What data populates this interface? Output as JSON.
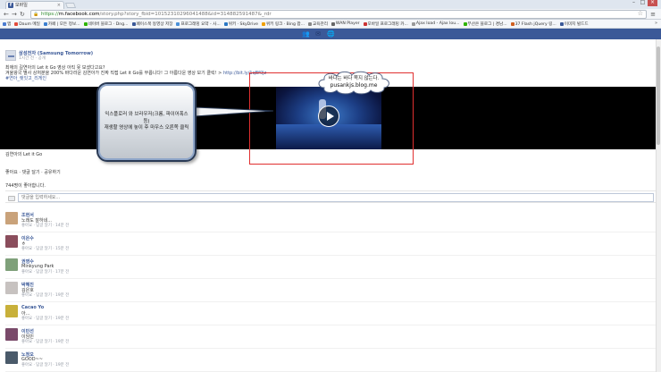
{
  "browser": {
    "tab_title": "모바일",
    "url_scheme": "https://",
    "url_domain": "m.facebook.com",
    "url_path": "/story.php?story_fbid=10152310296041488&id=314882591487&_rdr",
    "bookmarks": [
      {
        "label": "앱",
        "color": "#4a7bd0"
      },
      {
        "label": "Daum 메일",
        "color": "#e24b3b"
      },
      {
        "label": "카페 | 모든 정보...",
        "color": "#3b7fd0"
      },
      {
        "label": "네이버 블로그 · Dng...",
        "color": "#2db400"
      },
      {
        "label": "페이스북 동영상 저장",
        "color": "#3b5998"
      },
      {
        "label": "프로그래밍 요약 - 사...",
        "color": "#4a90d9"
      },
      {
        "label": "위키 · SkyDrive",
        "color": "#2b78c5"
      },
      {
        "label": "위키 링크 · Bing 팝...",
        "color": "#f0a000"
      },
      {
        "label": "교육관리",
        "color": "#888888"
      },
      {
        "label": "WAN Player",
        "color": "#666666"
      },
      {
        "label": "모바일 프로그래밍 카...",
        "color": "#cc3333"
      },
      {
        "label": "Ajax load - Ajax lou...",
        "color": "#999999"
      },
      {
        "label": "부산은 블로그 | 경남...",
        "color": "#2db400"
      },
      {
        "label": "37 Flash jQuery 링...",
        "color": "#d06020"
      },
      {
        "label": "이미지 빌드드",
        "color": "#3b5998"
      }
    ]
  },
  "post": {
    "author": "삼성전자 (Samsung Tomorrow)",
    "meta": "1시간 전 · 공개",
    "line1": "최애의 길연아의 Let it Go 영상 아직 못 보셨다고요?",
    "line2_prefix": "겨울왕국 별사 상처분을 200% 바다라운 김연아가 진짜 직접 Let it Go를 부릅니다! 그 아름다운 영상 보기 클릭!",
    "line2_link": "http://bit.ly/1qBf0Jz",
    "hashtag": "#연아_렛잇고_리게인",
    "caption": "김연아의 Let it Go",
    "actions": "좋아요 · 댓글 달기 · 공유하기",
    "likes_count": "744명이 좋아합니다.",
    "comment_placeholder": "댓글을 입력하세요..."
  },
  "comments": [
    {
      "name": "조현서",
      "text": "노래도 잘하네...",
      "meta": "좋아요 · 답글 달기 · 14분 전",
      "avatar_color": "#c9a27a"
    },
    {
      "name": "이은수",
      "text": "ㅎ",
      "meta": "좋아요 · 답글 달기 · 15분 전",
      "avatar_color": "#8a4d5c"
    },
    {
      "name": "권영수",
      "text": "Minkyung Park",
      "meta": "좋아요 · 답글 달기 · 17분 전",
      "avatar_color": "#7fa07a"
    },
    {
      "name": "박혜진",
      "text": "김은호",
      "meta": "좋아요 · 답글 달기 · 19분 전",
      "avatar_color": "#c7c2c0"
    },
    {
      "name": "Cacao Yo",
      "text": "아...",
      "meta": "좋아요 · 답글 달기 · 19분 전",
      "avatar_color": "#c8b03a"
    },
    {
      "name": "이민선",
      "text": "이임민",
      "meta": "좋아요 · 답글 달기 · 19분 전",
      "avatar_color": "#7a4a6a"
    },
    {
      "name": "노정오",
      "text": "GOOD~~",
      "meta": "좋아요 · 답글 달기 · 19분 전",
      "avatar_color": "#4a5a6a"
    }
  ],
  "annotations": {
    "callout_text": "익스플로러 와 브라우저(크롬, 파이어폭스등)\n재생할 영상에 놓이 후 마우스 오른쪽 클릭",
    "cloud_line1": "바다는 바다 쪽지 않는다.",
    "cloud_line2": "pusankjs.blog.me",
    "box_color": "#e03030"
  }
}
